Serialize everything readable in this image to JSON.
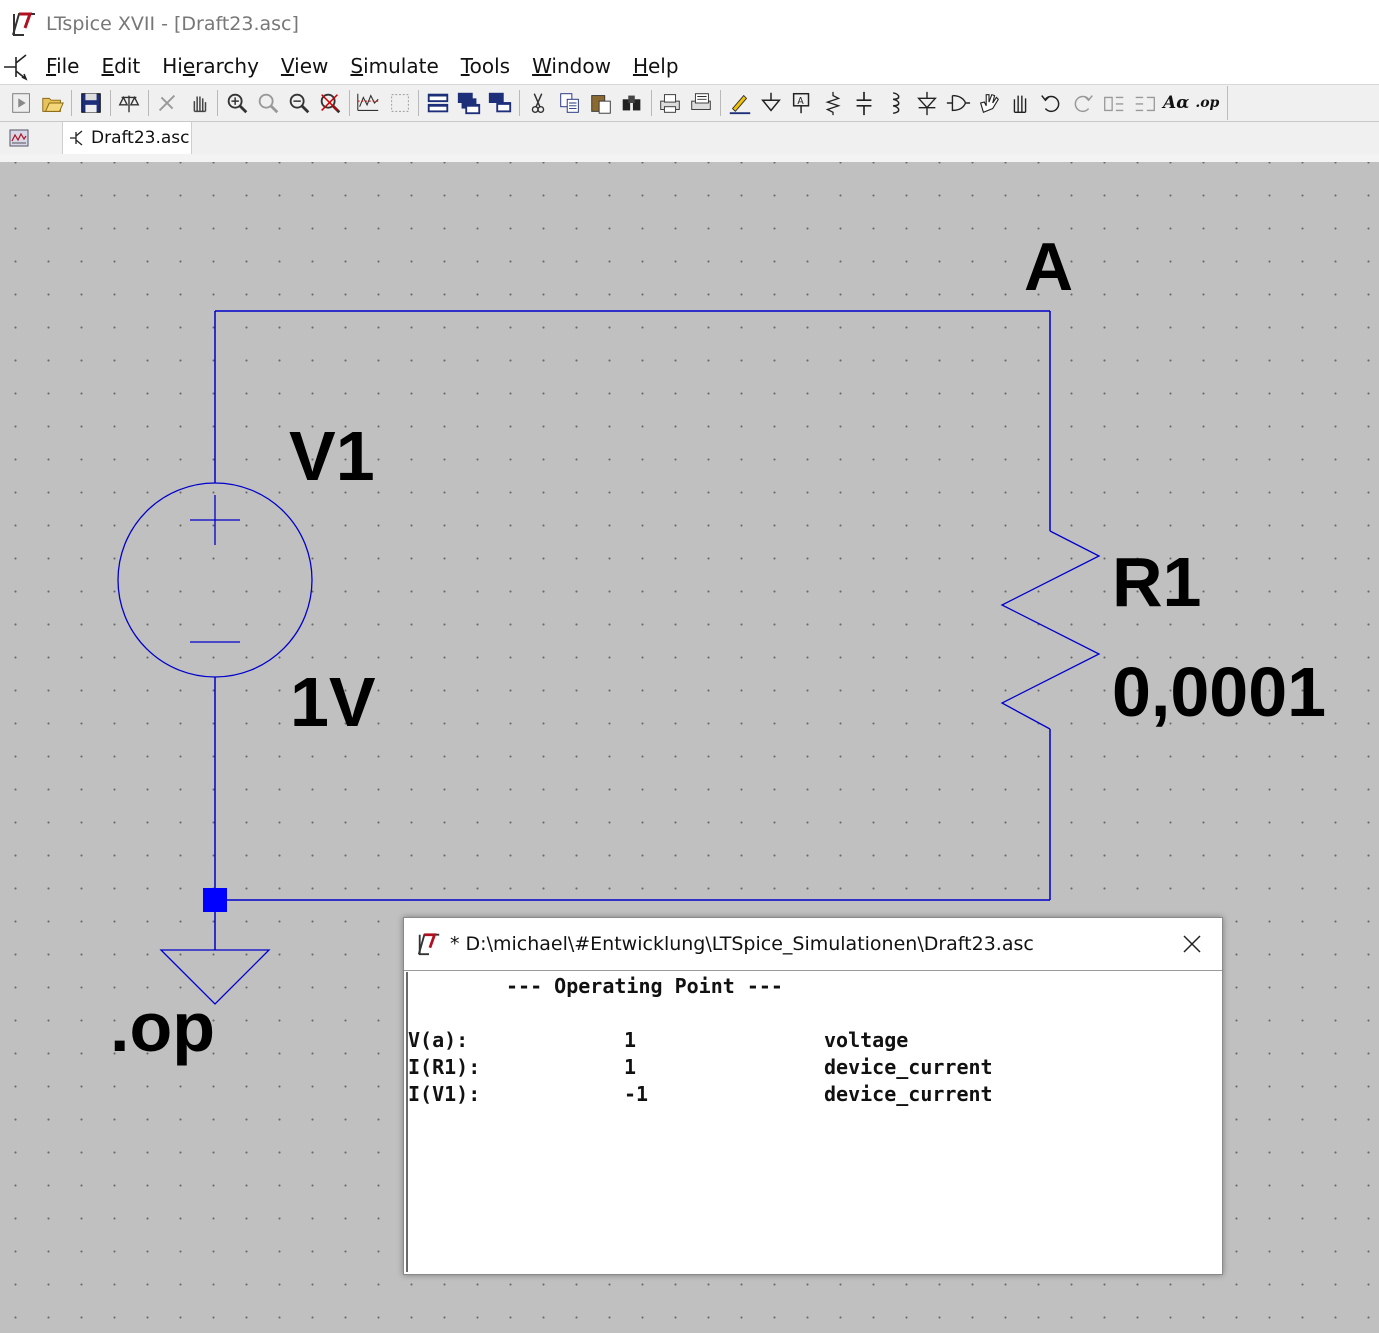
{
  "window": {
    "title": "LTspice XVII - [Draft23.asc]"
  },
  "menu": {
    "items": [
      {
        "pre": "",
        "ul": "F",
        "post": "ile"
      },
      {
        "pre": "",
        "ul": "E",
        "post": "dit"
      },
      {
        "pre": "Hi",
        "ul": "e",
        "post": "rarchy"
      },
      {
        "pre": "",
        "ul": "V",
        "post": "iew"
      },
      {
        "pre": "",
        "ul": "S",
        "post": "imulate"
      },
      {
        "pre": "",
        "ul": "T",
        "post": "ools"
      },
      {
        "pre": "",
        "ul": "W",
        "post": "indow"
      },
      {
        "pre": "",
        "ul": "H",
        "post": "elp"
      }
    ]
  },
  "toolbar": {
    "icons": [
      "run-icon",
      "open-icon",
      "save-icon",
      "control-panel-icon",
      "halt-icon",
      "pan-icon",
      "zoom-in-icon",
      "zoom-back-icon",
      "zoom-out-icon",
      "zoom-cancel-icon",
      "autorange-icon",
      "fit-icon",
      "tile-horizontal-icon",
      "cascade-icon",
      "tile-vertical-icon",
      "cut-icon",
      "copy-icon",
      "paste-icon",
      "find-icon",
      "print-icon",
      "print-preview-icon",
      "draw-wire-icon",
      "ground-icon",
      "label-net-icon",
      "resistor-icon",
      "capacitor-icon",
      "inductor-icon",
      "diode-icon",
      "component-icon",
      "move-icon",
      "drag-icon",
      "undo-icon",
      "redo-icon",
      "rotate-icon",
      "mirror-icon",
      "text-icon",
      "spice-directive-icon"
    ],
    "text_label": "Aα",
    "directive_label": ".op"
  },
  "tabs": {
    "active": "Draft23.asc"
  },
  "schematic": {
    "node_label": "A",
    "source_name": "V1",
    "source_value": "1V",
    "resistor_name": "R1",
    "resistor_value": "0,0001",
    "directive": ".op",
    "wire_color": "#0000cc",
    "node_marker_color": "#0000ff"
  },
  "output_window": {
    "title": "* D:\\michael\\#Entwicklung\\LTSpice_Simulationen\\Draft23.asc",
    "heading": "--- Operating Point ---",
    "rows": [
      {
        "name": "V(a):",
        "value": "1",
        "type": "voltage"
      },
      {
        "name": "I(R1):",
        "value": "1",
        "type": "device_current"
      },
      {
        "name": "I(V1):",
        "value": "-1",
        "type": "device_current"
      }
    ]
  }
}
